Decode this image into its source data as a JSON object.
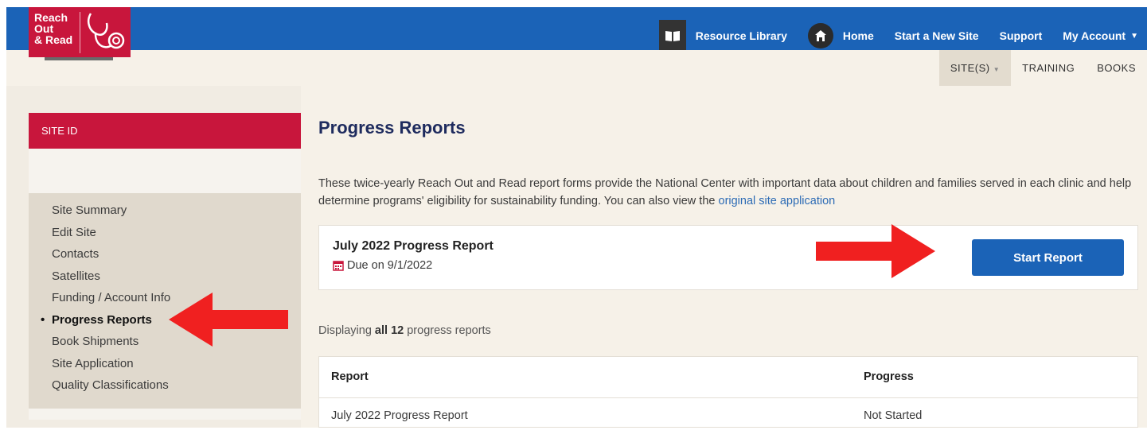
{
  "logo": {
    "line1": "Reach",
    "line2": "Out",
    "line3": "& Read"
  },
  "topnav": {
    "resource_library": "Resource Library",
    "home": "Home",
    "start_new_site": "Start a New Site",
    "support": "Support",
    "my_account": "My Account"
  },
  "subnav": {
    "sites": "SITE(S)",
    "training": "TRAINING",
    "books": "BOOKS"
  },
  "sidebar": {
    "site_id_label": "SITE ID",
    "items": [
      {
        "label": "Site Summary"
      },
      {
        "label": "Edit Site"
      },
      {
        "label": "Contacts"
      },
      {
        "label": "Satellites"
      },
      {
        "label": "Funding / Account Info"
      },
      {
        "label": "Progress Reports"
      },
      {
        "label": "Book Shipments"
      },
      {
        "label": "Site Application"
      },
      {
        "label": "Quality Classifications"
      }
    ]
  },
  "main": {
    "title": "Progress Reports",
    "intro": "These twice-yearly Reach Out and Read report forms provide the National Center with important data about children and families served in each clinic and help determine programs' eligibility for sustainability funding. You can also view the ",
    "intro_link": "original site application",
    "card": {
      "title": "July 2022 Progress Report",
      "due": "Due on 9/1/2022",
      "button": "Start Report"
    },
    "displaying": {
      "prefix": "Displaying ",
      "bold": "all 12",
      "suffix": " progress reports"
    },
    "table": {
      "headers": [
        "Report",
        "Progress"
      ],
      "rows": [
        [
          "July 2022 Progress Report",
          "Not Started"
        ]
      ]
    }
  },
  "colors": {
    "brand_red": "#c8163c",
    "brand_blue": "#1b63b7",
    "arrow": "#f02020"
  }
}
